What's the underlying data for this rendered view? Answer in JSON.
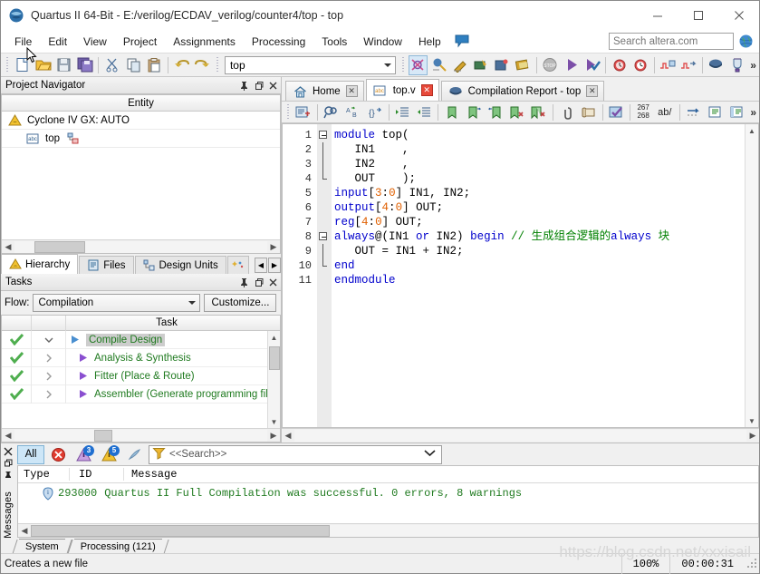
{
  "window": {
    "title": "Quartus II 64-Bit - E:/verilog/ECDAV_verilog/counter4/top - top",
    "minimize": "—",
    "maximize": "□",
    "close": "✕"
  },
  "menu": {
    "items": [
      {
        "label": "File"
      },
      {
        "label": "Edit"
      },
      {
        "label": "View"
      },
      {
        "label": "Project"
      },
      {
        "label": "Assignments"
      },
      {
        "label": "Processing"
      },
      {
        "label": "Tools"
      },
      {
        "label": "Window"
      },
      {
        "label": "Help"
      }
    ]
  },
  "search": {
    "placeholder": "Search altera.com",
    "value": ""
  },
  "toolbar": {
    "entity_combo": "top",
    "overflow": "»",
    "buttons": [
      {
        "name": "new-file-icon"
      },
      {
        "name": "open-file-icon"
      },
      {
        "name": "save-file-icon"
      },
      {
        "name": "save-all-icon"
      },
      {
        "name": "cut-icon"
      },
      {
        "name": "copy-icon"
      },
      {
        "name": "paste-icon"
      },
      {
        "name": "undo-icon"
      },
      {
        "name": "redo-icon"
      }
    ]
  },
  "project_navigator": {
    "title": "Project Navigator",
    "column_header": "Entity",
    "rows": [
      {
        "label": "Cyclone IV GX: AUTO",
        "icon": "device-warning-icon"
      },
      {
        "label": "top",
        "icon": "verilog-file-icon"
      }
    ],
    "tabs": [
      {
        "label": "Hierarchy",
        "icon": "hierarchy-icon",
        "active": true
      },
      {
        "label": "Files",
        "icon": "files-icon",
        "active": false
      },
      {
        "label": "Design Units",
        "icon": "design-units-icon",
        "active": false
      }
    ]
  },
  "tasks": {
    "title": "Tasks",
    "flow_label": "Flow:",
    "flow_value": "Compilation",
    "customize_label": "Customize...",
    "column_header": "Task",
    "rows": [
      {
        "label": "Compile Design",
        "status": "done",
        "level": 1,
        "selected": true
      },
      {
        "label": "Analysis & Synthesis",
        "status": "done",
        "level": 2,
        "selected": false
      },
      {
        "label": "Fitter (Place & Route)",
        "status": "done",
        "level": 2,
        "selected": false
      },
      {
        "label": "Assembler (Generate programming files)",
        "status": "done",
        "level": 2,
        "selected": false
      }
    ]
  },
  "editor": {
    "tabs": [
      {
        "label": "Home",
        "icon": "home-icon",
        "active": false,
        "close": "✕"
      },
      {
        "label": "top.v",
        "icon": "verilog-file-icon",
        "active": true,
        "close": "✕"
      },
      {
        "label": "Compilation Report - top",
        "icon": "report-icon",
        "active": false,
        "close": "✕"
      }
    ],
    "line_indicator_top": "267",
    "line_indicator_bottom": "268",
    "ab_label": "ab/",
    "overflow": "»",
    "code_lines": [
      {
        "n": "1",
        "fold": "start",
        "tokens": [
          {
            "t": "module ",
            "c": "kw"
          },
          {
            "t": "top(",
            "c": "id"
          }
        ]
      },
      {
        "n": "2",
        "fold": "bar",
        "tokens": [
          {
            "t": "   IN1    ,",
            "c": "id"
          }
        ]
      },
      {
        "n": "3",
        "fold": "bar",
        "tokens": [
          {
            "t": "   IN2    ,",
            "c": "id"
          }
        ]
      },
      {
        "n": "4",
        "fold": "end",
        "tokens": [
          {
            "t": "   OUT    );",
            "c": "id"
          }
        ]
      },
      {
        "n": "5",
        "fold": "none",
        "tokens": [
          {
            "t": "input",
            "c": "kw"
          },
          {
            "t": "[",
            "c": "id"
          },
          {
            "t": "3",
            "c": "num"
          },
          {
            "t": ":",
            "c": "id"
          },
          {
            "t": "0",
            "c": "num"
          },
          {
            "t": "] IN1, IN2;",
            "c": "id"
          }
        ]
      },
      {
        "n": "6",
        "fold": "none",
        "tokens": [
          {
            "t": "output",
            "c": "kw"
          },
          {
            "t": "[",
            "c": "id"
          },
          {
            "t": "4",
            "c": "num"
          },
          {
            "t": ":",
            "c": "id"
          },
          {
            "t": "0",
            "c": "num"
          },
          {
            "t": "] OUT;",
            "c": "id"
          }
        ]
      },
      {
        "n": "7",
        "fold": "none",
        "tokens": [
          {
            "t": "reg",
            "c": "kw"
          },
          {
            "t": "[",
            "c": "id"
          },
          {
            "t": "4",
            "c": "num"
          },
          {
            "t": ":",
            "c": "id"
          },
          {
            "t": "0",
            "c": "num"
          },
          {
            "t": "] OUT;",
            "c": "id"
          }
        ]
      },
      {
        "n": "8",
        "fold": "start",
        "tokens": [
          {
            "t": "always",
            "c": "kw"
          },
          {
            "t": "@(IN1 ",
            "c": "id"
          },
          {
            "t": "or",
            "c": "kw"
          },
          {
            "t": " IN2) ",
            "c": "id"
          },
          {
            "t": "begin",
            "c": "kw"
          },
          {
            "t": " ",
            "c": "id"
          },
          {
            "t": "// 生成组合逻辑的",
            "c": "cmt"
          },
          {
            "t": "always",
            "c": "kw"
          },
          {
            "t": " 块",
            "c": "cmt"
          }
        ]
      },
      {
        "n": "9",
        "fold": "bar",
        "tokens": [
          {
            "t": "   OUT = IN1 + IN2;",
            "c": "id"
          }
        ]
      },
      {
        "n": "10",
        "fold": "end",
        "tokens": [
          {
            "t": "end",
            "c": "kw"
          }
        ]
      },
      {
        "n": "11",
        "fold": "none",
        "tokens": [
          {
            "t": "endmodule",
            "c": "kw"
          }
        ]
      }
    ]
  },
  "messages": {
    "side_label": "Messages",
    "filter_all": "All",
    "badge_critical": "3",
    "badge_warning": "5",
    "search_placeholder": "<<Search>>",
    "columns": [
      "Type",
      "ID",
      "Message"
    ],
    "rows": [
      {
        "type_icon": "info-icon",
        "id": "293000",
        "text": "Quartus II Full Compilation was successful. 0 errors, 8 warnings"
      }
    ],
    "tabs": [
      {
        "label": "System",
        "active": false
      },
      {
        "label": "Processing (121)",
        "active": true
      }
    ]
  },
  "statusbar": {
    "hint": "Creates a new file",
    "zoom": "100%",
    "elapsed": "00:00:31"
  },
  "watermark": "https://blog.csdn.net/xxxisail"
}
